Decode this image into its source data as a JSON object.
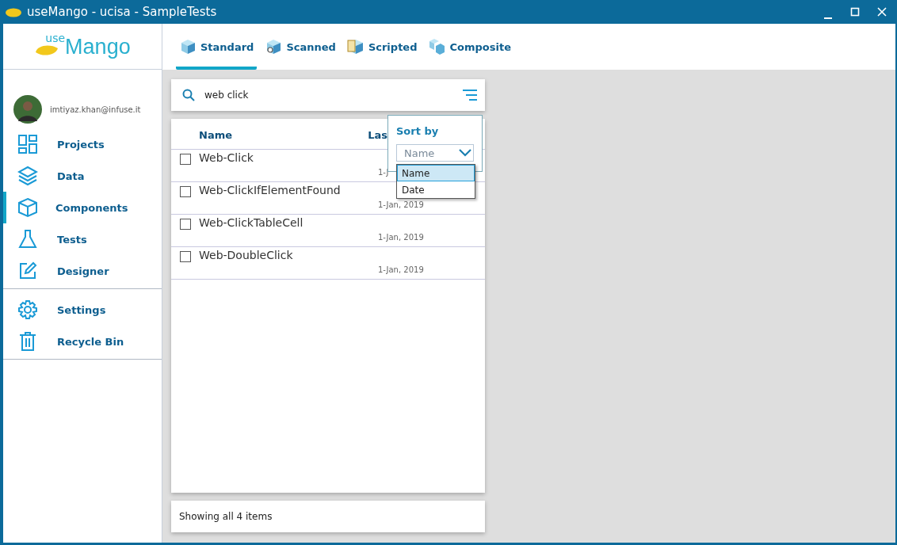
{
  "window": {
    "title": "useMango - ucisa - SampleTests"
  },
  "logo": {
    "prefix": "use",
    "name": "Mango"
  },
  "tabs": [
    {
      "label": "Standard",
      "selected": true
    },
    {
      "label": "Scanned",
      "selected": false
    },
    {
      "label": "Scripted",
      "selected": false
    },
    {
      "label": "Composite",
      "selected": false
    }
  ],
  "user": {
    "email": "imtiyaz.khan@infuse.it"
  },
  "sidebar": {
    "main": [
      {
        "label": "Projects",
        "selected": false
      },
      {
        "label": "Data",
        "selected": false
      },
      {
        "label": "Components",
        "selected": true
      },
      {
        "label": "Tests",
        "selected": false
      },
      {
        "label": "Designer",
        "selected": false
      }
    ],
    "bottom": [
      {
        "label": "Settings",
        "selected": false
      },
      {
        "label": "Recycle Bin",
        "selected": false
      }
    ]
  },
  "search": {
    "value": "web click"
  },
  "table": {
    "columns": [
      "Name",
      "Las"
    ],
    "rows": [
      {
        "name": "Web-Click",
        "date": "1-J",
        "checked": false
      },
      {
        "name": "Web-ClickIfElementFound",
        "date": "1-Jan, 2019",
        "checked": false
      },
      {
        "name": "Web-ClickTableCell",
        "date": "1-Jan, 2019",
        "checked": false
      },
      {
        "name": "Web-DoubleClick",
        "date": "1-Jan, 2019",
        "checked": false
      }
    ]
  },
  "sort": {
    "title": "Sort by",
    "value": "Name",
    "options": [
      {
        "label": "Name",
        "selected": true
      },
      {
        "label": "Date",
        "selected": false
      }
    ]
  },
  "status_bar": "Showing all 4 items"
}
